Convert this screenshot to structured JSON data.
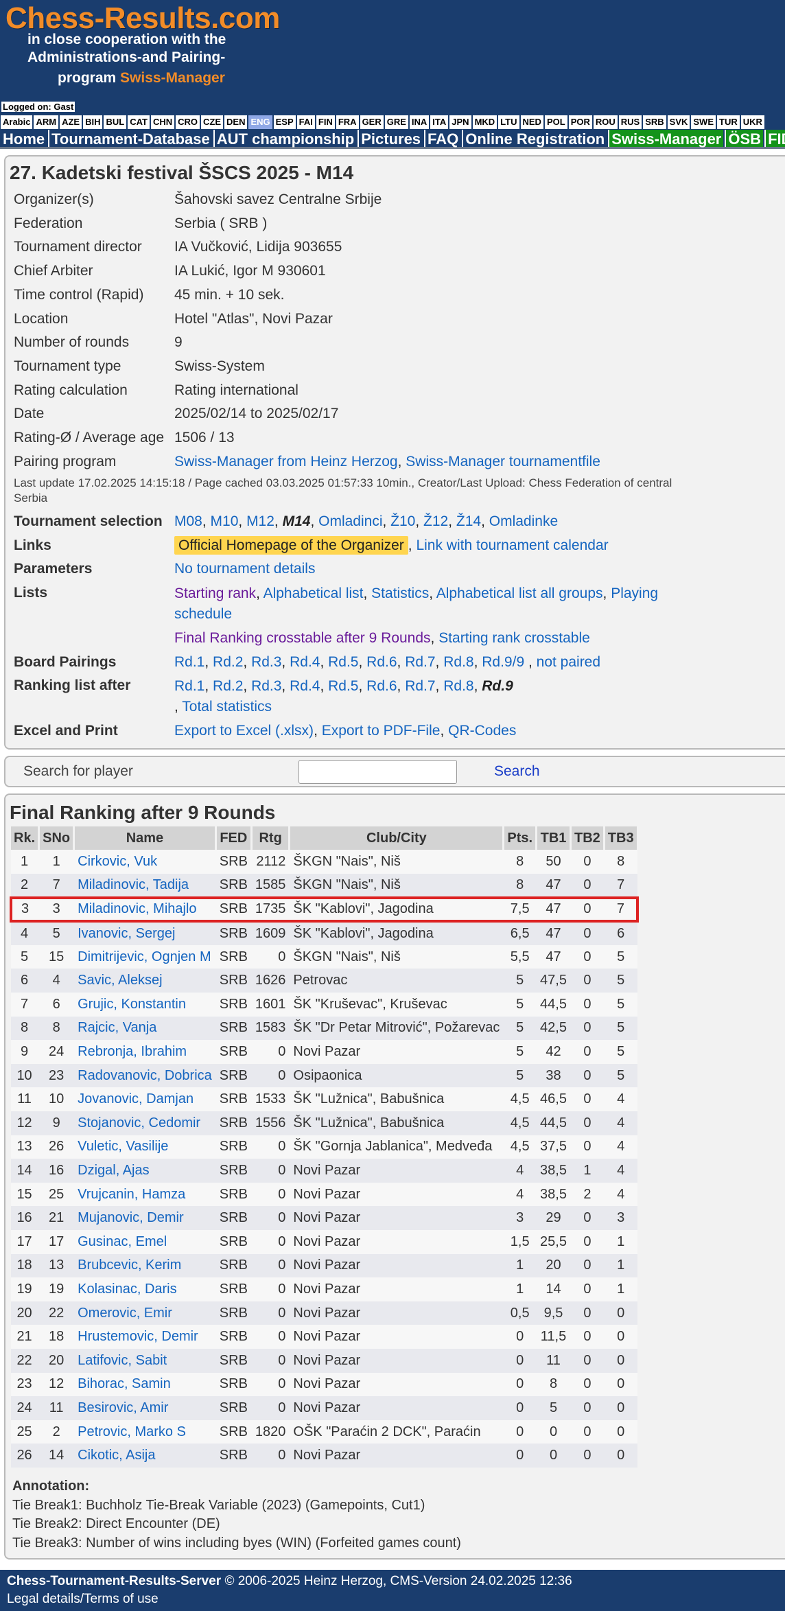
{
  "header": {
    "logo_title": "Chess-Results.com",
    "line1": "in close cooperation with the",
    "line2": "Administrations-and Pairing-",
    "line3_prefix": "program ",
    "line3_accent": "Swiss-Manager"
  },
  "logged_on": {
    "label": "Logged on:",
    "user": "Gast"
  },
  "languages": [
    "Arabic",
    "ARM",
    "AZE",
    "BIH",
    "BUL",
    "CAT",
    "CHN",
    "CRO",
    "CZE",
    "DEN",
    "ENG",
    "ESP",
    "FAI",
    "FIN",
    "FRA",
    "GER",
    "GRE",
    "INA",
    "ITA",
    "JPN",
    "MKD",
    "LTU",
    "NED",
    "POL",
    "POR",
    "ROU",
    "RUS",
    "SRB",
    "SVK",
    "SWE",
    "TUR",
    "UKR"
  ],
  "active_language": "ENG",
  "menu": [
    {
      "label": "Home",
      "green": false
    },
    {
      "label": "Tournament-Database",
      "green": false
    },
    {
      "label": "AUT championship",
      "green": false
    },
    {
      "label": "Pictures",
      "green": false
    },
    {
      "label": "FAQ",
      "green": false
    },
    {
      "label": "Online Registration",
      "green": false
    },
    {
      "label": "Swiss-Manager",
      "green": true
    },
    {
      "label": "ÖSB",
      "green": true
    },
    {
      "label": "FIDE",
      "green": true
    }
  ],
  "tournament": {
    "title": "27. Kadetski festival ŠSCS 2025 - M14",
    "info": [
      {
        "label": "Organizer(s)",
        "value": "Šahovski savez Centralne Srbije"
      },
      {
        "label": "Federation",
        "value": "Serbia ( SRB )"
      },
      {
        "label": "Tournament director",
        "value": "IA Vučković, Lidija 903655"
      },
      {
        "label": "Chief Arbiter",
        "value": "IA Lukić, Igor M 930601"
      },
      {
        "label": "Time control (Rapid)",
        "value": "45 min. + 10 sek."
      },
      {
        "label": "Location",
        "value": "Hotel \"Atlas\", Novi Pazar"
      },
      {
        "label": "Number of rounds",
        "value": "9"
      },
      {
        "label": "Tournament type",
        "value": "Swiss-System"
      },
      {
        "label": "Rating calculation",
        "value": "Rating international"
      },
      {
        "label": "Date",
        "value": "2025/02/14 to 2025/02/17"
      },
      {
        "label": "Rating-Ø / Average age",
        "value": "1506 / 13"
      }
    ],
    "pairing_program": {
      "label": "Pairing program",
      "link1": "Swiss-Manager from Heinz Herzog",
      "link2": "Swiss-Manager tournamentfile"
    },
    "last_update": "Last update 17.02.2025 14:15:18 / Page cached 03.03.2025 01:57:33 10min., Creator/Last Upload: Chess Federation of central Serbia"
  },
  "selection": {
    "tournament_selection": {
      "label": "Tournament selection",
      "items": [
        "M08",
        "M10",
        "M12",
        "M14",
        "Omladinci",
        "Ž10",
        "Ž12",
        "Ž14",
        "Omladinke"
      ],
      "current": "M14"
    },
    "links": {
      "label": "Links",
      "item1": "Official Homepage of the Organizer",
      "item2": "Link with tournament calendar"
    },
    "parameters": {
      "label": "Parameters",
      "value": "No tournament details"
    },
    "lists": {
      "label": "Lists",
      "line1": [
        "Starting rank",
        "Alphabetical list",
        "Statistics",
        "Alphabetical list all groups",
        "Playing schedule"
      ],
      "line2": [
        "Final Ranking crosstable after 9 Rounds",
        "Starting rank crosstable"
      ]
    },
    "board_pairings": {
      "label": "Board Pairings",
      "items": [
        "Rd.1",
        "Rd.2",
        "Rd.3",
        "Rd.4",
        "Rd.5",
        "Rd.6",
        "Rd.7",
        "Rd.8",
        "Rd.9/9"
      ],
      "extra": "not paired"
    },
    "ranking_list": {
      "label": "Ranking list after",
      "items": [
        "Rd.1",
        "Rd.2",
        "Rd.3",
        "Rd.4",
        "Rd.5",
        "Rd.6",
        "Rd.7",
        "Rd.8",
        "Rd.9"
      ],
      "extra": "Total statistics"
    },
    "excel": {
      "label": "Excel and Print",
      "items": [
        "Export to Excel (.xlsx)",
        "Export to PDF-File",
        "QR-Codes"
      ]
    }
  },
  "search": {
    "label": "Search for player",
    "button": "Search",
    "placeholder": ""
  },
  "ranking": {
    "title": "Final Ranking after 9 Rounds",
    "columns": [
      "Rk.",
      "SNo",
      "Name",
      "FED",
      "Rtg",
      "Club/City",
      "Pts.",
      "TB1",
      "TB2",
      "TB3"
    ],
    "highlight_rank": "3",
    "rows": [
      [
        "1",
        "1",
        "Cirkovic, Vuk",
        "SRB",
        "2112",
        "ŠKGN \"Nais\", Niš",
        "8",
        "50",
        "0",
        "8"
      ],
      [
        "2",
        "7",
        "Miladinovic, Tadija",
        "SRB",
        "1585",
        "ŠKGN \"Nais\", Niš",
        "8",
        "47",
        "0",
        "7"
      ],
      [
        "3",
        "3",
        "Miladinovic, Mihajlo",
        "SRB",
        "1735",
        "ŠK \"Kablovi\", Jagodina",
        "7,5",
        "47",
        "0",
        "7"
      ],
      [
        "4",
        "5",
        "Ivanovic, Sergej",
        "SRB",
        "1609",
        "ŠK \"Kablovi\", Jagodina",
        "6,5",
        "47",
        "0",
        "6"
      ],
      [
        "5",
        "15",
        "Dimitrijevic, Ognjen M",
        "SRB",
        "0",
        "ŠKGN \"Nais\", Niš",
        "5,5",
        "47",
        "0",
        "5"
      ],
      [
        "6",
        "4",
        "Savic, Aleksej",
        "SRB",
        "1626",
        "Petrovac",
        "5",
        "47,5",
        "0",
        "5"
      ],
      [
        "7",
        "6",
        "Grujic, Konstantin",
        "SRB",
        "1601",
        "ŠK \"Kruševac\", Kruševac",
        "5",
        "44,5",
        "0",
        "5"
      ],
      [
        "8",
        "8",
        "Rajcic, Vanja",
        "SRB",
        "1583",
        "ŠK \"Dr Petar Mitrović\", Požarevac",
        "5",
        "42,5",
        "0",
        "5"
      ],
      [
        "9",
        "24",
        "Rebronja, Ibrahim",
        "SRB",
        "0",
        "Novi Pazar",
        "5",
        "42",
        "0",
        "5"
      ],
      [
        "10",
        "23",
        "Radovanovic, Dobrica",
        "SRB",
        "0",
        "Osipaonica",
        "5",
        "38",
        "0",
        "5"
      ],
      [
        "11",
        "10",
        "Jovanovic, Damjan",
        "SRB",
        "1533",
        "ŠK \"Lužnica\", Babušnica",
        "4,5",
        "46,5",
        "0",
        "4"
      ],
      [
        "12",
        "9",
        "Stojanovic, Cedomir",
        "SRB",
        "1556",
        "ŠK \"Lužnica\", Babušnica",
        "4,5",
        "44,5",
        "0",
        "4"
      ],
      [
        "13",
        "26",
        "Vuletic, Vasilije",
        "SRB",
        "0",
        "ŠK \"Gornja Jablanica\", Medveđa",
        "4,5",
        "37,5",
        "0",
        "4"
      ],
      [
        "14",
        "16",
        "Dzigal, Ajas",
        "SRB",
        "0",
        "Novi Pazar",
        "4",
        "38,5",
        "1",
        "4"
      ],
      [
        "15",
        "25",
        "Vrujcanin, Hamza",
        "SRB",
        "0",
        "Novi Pazar",
        "4",
        "38,5",
        "2",
        "4"
      ],
      [
        "16",
        "21",
        "Mujanovic, Demir",
        "SRB",
        "0",
        "Novi Pazar",
        "3",
        "29",
        "0",
        "3"
      ],
      [
        "17",
        "17",
        "Gusinac, Emel",
        "SRB",
        "0",
        "Novi Pazar",
        "1,5",
        "25,5",
        "0",
        "1"
      ],
      [
        "18",
        "13",
        "Brubcevic, Kerim",
        "SRB",
        "0",
        "Novi Pazar",
        "1",
        "20",
        "0",
        "1"
      ],
      [
        "19",
        "19",
        "Kolasinac, Daris",
        "SRB",
        "0",
        "Novi Pazar",
        "1",
        "14",
        "0",
        "1"
      ],
      [
        "20",
        "22",
        "Omerovic, Emir",
        "SRB",
        "0",
        "Novi Pazar",
        "0,5",
        "9,5",
        "0",
        "0"
      ],
      [
        "21",
        "18",
        "Hrustemovic, Demir",
        "SRB",
        "0",
        "Novi Pazar",
        "0",
        "11,5",
        "0",
        "0"
      ],
      [
        "22",
        "20",
        "Latifovic, Sabit",
        "SRB",
        "0",
        "Novi Pazar",
        "0",
        "11",
        "0",
        "0"
      ],
      [
        "23",
        "12",
        "Bihorac, Samin",
        "SRB",
        "0",
        "Novi Pazar",
        "0",
        "8",
        "0",
        "0"
      ],
      [
        "24",
        "11",
        "Besirovic, Amir",
        "SRB",
        "0",
        "Novi Pazar",
        "0",
        "5",
        "0",
        "0"
      ],
      [
        "25",
        "2",
        "Petrovic, Marko S",
        "SRB",
        "1820",
        "OŠK \"Paraćin 2 DCK\", Paraćin",
        "0",
        "0",
        "0",
        "0"
      ],
      [
        "26",
        "14",
        "Cikotic, Asija",
        "SRB",
        "0",
        "Novi Pazar",
        "0",
        "0",
        "0",
        "0"
      ]
    ]
  },
  "annotation": {
    "title": "Annotation:",
    "lines": [
      "Tie Break1: Buchholz Tie-Break Variable (2023) (Gamepoints, Cut1)",
      "Tie Break2: Direct Encounter (DE)",
      "Tie Break3: Number of wins including byes (WIN) (Forfeited games count)"
    ]
  },
  "footer": {
    "server": "Chess-Tournament-Results-Server",
    "copyright": " © 2006-2025 Heinz Herzog, CMS-Version 24.02.2025 12:36",
    "legal": "Legal details/Terms of use"
  }
}
